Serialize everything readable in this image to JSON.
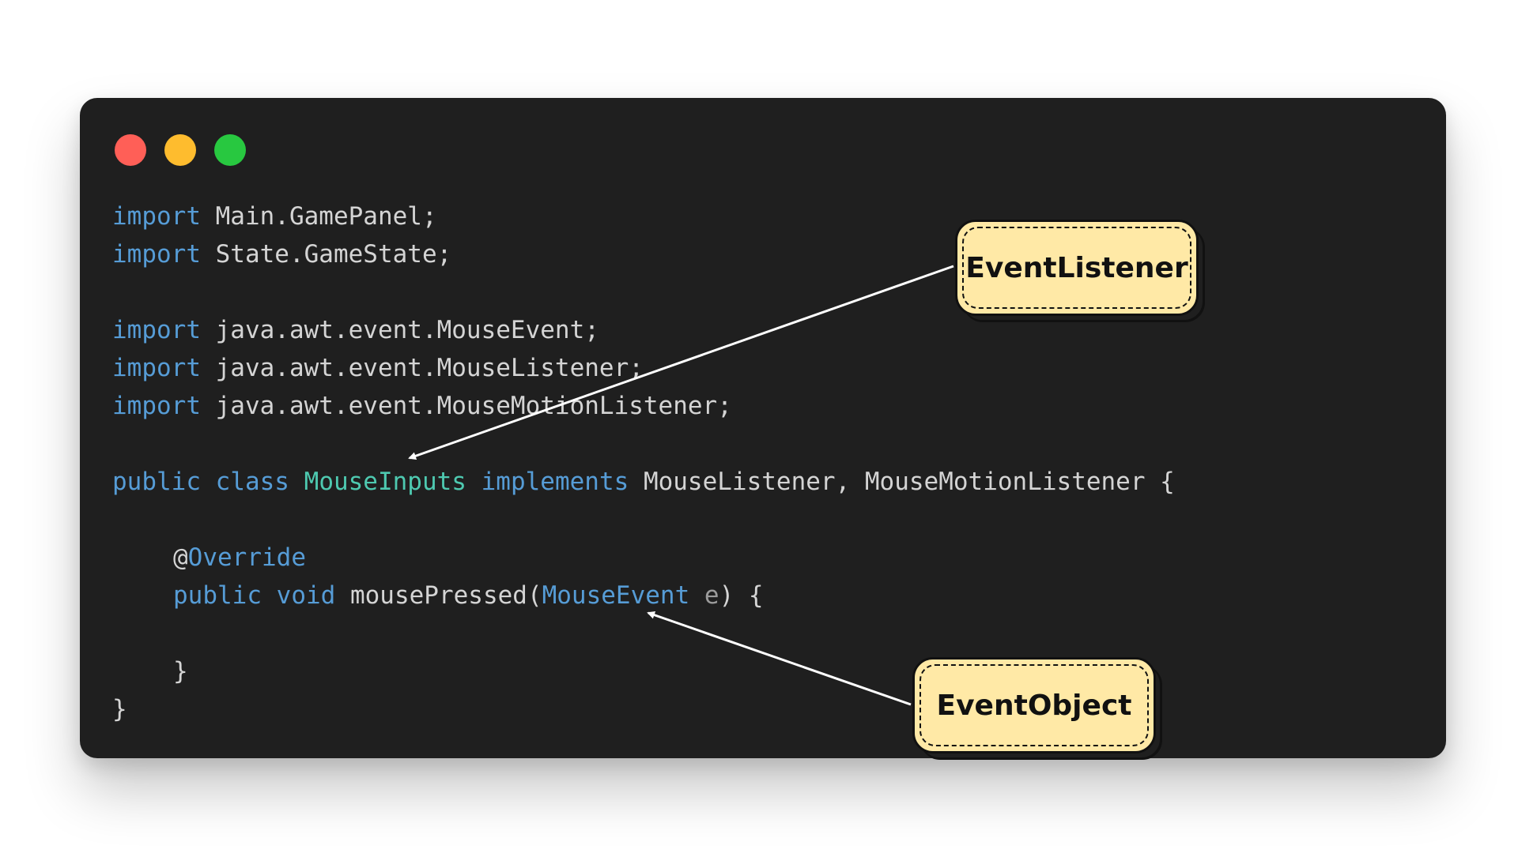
{
  "window": {
    "dots": [
      {
        "name": "close",
        "color": "#ff5f57"
      },
      {
        "name": "minimize",
        "color": "#febc2e"
      },
      {
        "name": "maximize",
        "color": "#28c840"
      }
    ]
  },
  "code": {
    "import_kw": "import",
    "line1_rest": " Main.GamePanel;",
    "line2_rest": " State.GameState;",
    "line4_rest": " java.awt.event.MouseEvent;",
    "line5_rest": " java.awt.event.MouseListener;",
    "line6_rest": " java.awt.event.MouseMotionListener;",
    "public_kw": "public",
    "class_kw": "class",
    "class_name": "MouseInputs",
    "implements_kw": "implements",
    "interfaces": " MouseListener, MouseMotionListener {",
    "at_sign": "@",
    "override_kw": "Override",
    "void_kw": "void",
    "method_name": " mousePressed(",
    "param_type": "MouseEvent",
    "param_name": " e",
    "method_end": ") {",
    "inner_close": "}",
    "outer_close": "}"
  },
  "callouts": {
    "listener_label": "EventListener",
    "object_label": "EventObject"
  },
  "colors": {
    "keyword": "#569cd6",
    "type": "#4ec9b0",
    "text": "#d4d4d4",
    "callout_bg": "#ffe9a6",
    "window_bg": "#1f1f1f"
  }
}
